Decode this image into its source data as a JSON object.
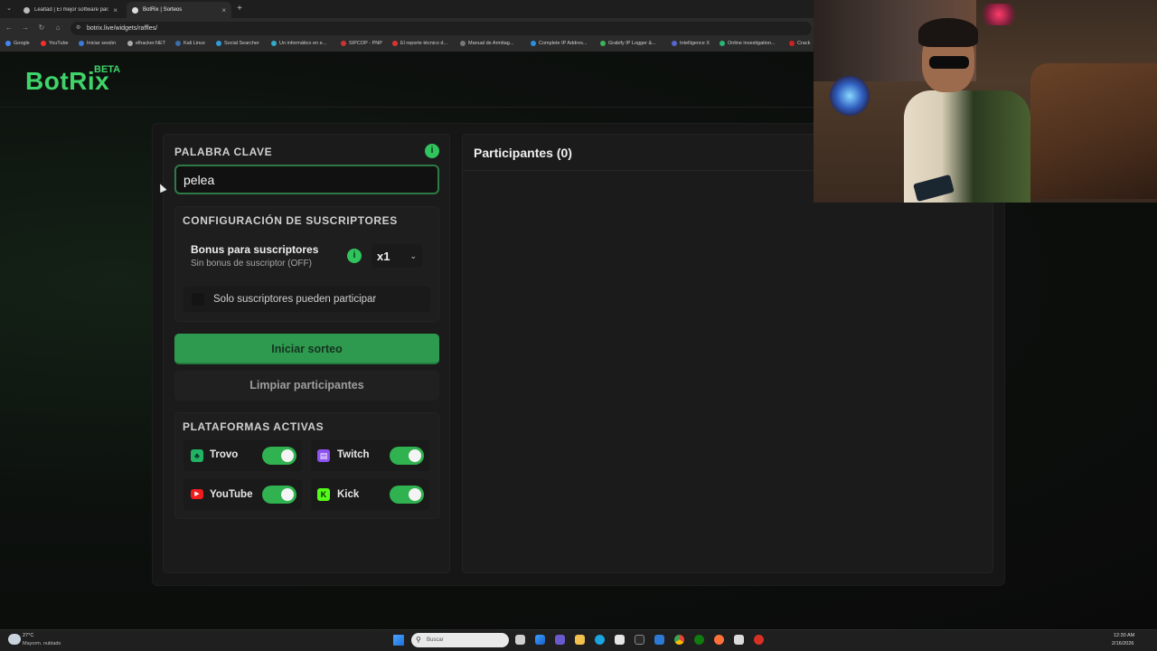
{
  "browser": {
    "tabs": [
      {
        "title": "Lealtad | El mejor software para..."
      },
      {
        "title": "BotRix | Sorteos"
      }
    ],
    "url": "botrix.live/widgets/raffles/",
    "bookmarks": [
      "Google",
      "YouTube",
      "Iniciar sesión",
      "elhacker.NET",
      "Kali Linux",
      "Social Searcher",
      "Un informático en e...",
      "SIPCOP - PNP",
      "El reporte técnico d...",
      "Manual de Armitag...",
      "Complete IP Addres...",
      "Grabify IP Logger &...",
      "Intelligence X",
      "Online investigation...",
      "Crack"
    ]
  },
  "brand": {
    "name": "BotRix",
    "badge": "BETA",
    "accent": "#3fd469"
  },
  "keyword": {
    "title": "PALABRA CLAVE",
    "value": "pelea"
  },
  "subscribers": {
    "title": "CONFIGURACIÓN DE SUSCRIPTORES",
    "bonus_title": "Bonus para suscriptores",
    "bonus_sub": "Sin bonus de suscriptor (OFF)",
    "multiplier": "x1",
    "only_subs_label": "Solo suscriptores pueden participar"
  },
  "actions": {
    "start": "Iniciar sorteo",
    "clear": "Limpiar participantes"
  },
  "platforms": {
    "title": "PLATAFORMAS ACTIVAS",
    "items": [
      {
        "name": "Trovo",
        "enabled": true
      },
      {
        "name": "Twitch",
        "enabled": true
      },
      {
        "name": "YouTube",
        "enabled": true
      },
      {
        "name": "Kick",
        "enabled": true
      }
    ]
  },
  "participants": {
    "title": "Participantes (0)"
  },
  "taskbar": {
    "temp": "27°C",
    "weather": "Mayorm. nublado",
    "search_placeholder": "Buscar",
    "time": "12:30 AM",
    "date": "2/16/2026"
  }
}
